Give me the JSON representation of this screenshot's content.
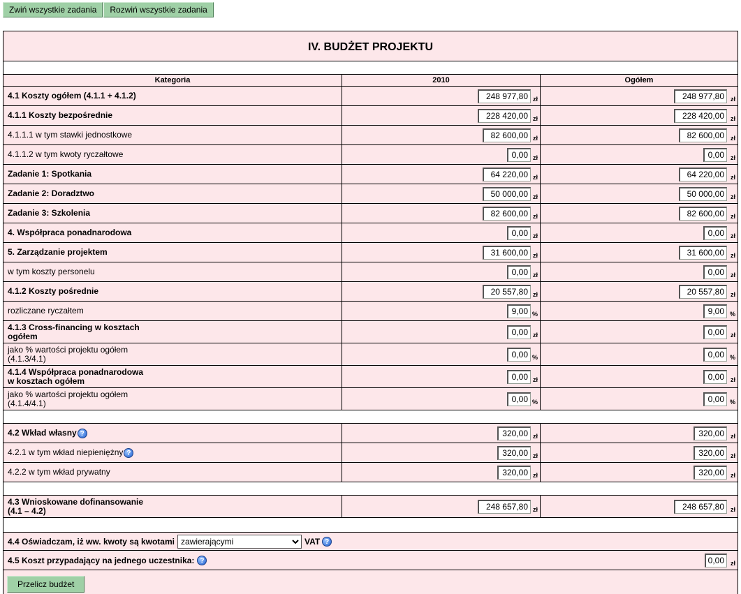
{
  "toolbar": {
    "collapse_label": "Zwiń wszystkie zadania",
    "expand_label": "Rozwiń wszystkie zadania"
  },
  "title": "IV. BUDŻET PROJEKTU",
  "headers": {
    "category": "Kategoria",
    "year": "2010",
    "total": "Ogółem"
  },
  "rows": [
    {
      "label": "4.1 Koszty ogółem (4.1.1 + 4.1.2)",
      "bold": true,
      "v2010": "248 977,80",
      "vtotal": "248 977,80",
      "unit": "zł"
    },
    {
      "label": "4.1.1 Koszty bezpośrednie",
      "bold": true,
      "v2010": "228 420,00",
      "vtotal": "228 420,00",
      "unit": "zł"
    },
    {
      "label": "4.1.1.1 w tym stawki jednostkowe",
      "bold": false,
      "v2010": "82 600,00",
      "vtotal": "82 600,00",
      "unit": "zł"
    },
    {
      "label": "4.1.1.2 w tym kwoty ryczałtowe",
      "bold": false,
      "v2010": "0,00",
      "vtotal": "0,00",
      "unit": "zł"
    },
    {
      "label": "Zadanie 1: Spotkania",
      "bold": true,
      "v2010": "64 220,00",
      "vtotal": "64 220,00",
      "unit": "zł"
    },
    {
      "label": "Zadanie 2: Doradztwo",
      "bold": true,
      "v2010": "50 000,00",
      "vtotal": "50 000,00",
      "unit": "zł"
    },
    {
      "label": "Zadanie 3: Szkolenia",
      "bold": true,
      "v2010": "82 600,00",
      "vtotal": "82 600,00",
      "unit": "zł"
    },
    {
      "label": "4. Współpraca ponadnarodowa",
      "bold": true,
      "v2010": "0,00",
      "vtotal": "0,00",
      "unit": "zł"
    },
    {
      "label": "5. Zarządzanie projektem",
      "bold": true,
      "v2010": "31 600,00",
      "vtotal": "31 600,00",
      "unit": "zł"
    },
    {
      "label": "w tym koszty personelu",
      "bold": false,
      "v2010": "0,00",
      "vtotal": "0,00",
      "unit": "zł"
    },
    {
      "label": "4.1.2 Koszty pośrednie",
      "bold": true,
      "v2010": "20 557,80",
      "vtotal": "20 557,80",
      "unit": "zł"
    },
    {
      "label": "rozliczane ryczałtem",
      "bold": false,
      "v2010": "9,00",
      "vtotal": "9,00",
      "unit": "%"
    },
    {
      "label": "4.1.3 Cross-financing w kosztach\nogółem",
      "bold": true,
      "v2010": "0,00",
      "vtotal": "0,00",
      "unit": "zł"
    },
    {
      "label": "jako % wartości projektu ogółem\n(4.1.3/4.1)",
      "bold": false,
      "v2010": "0,00",
      "vtotal": "0,00",
      "unit": "%"
    },
    {
      "label": "4.1.4 Współpraca ponadnarodowa\nw kosztach ogółem",
      "bold": true,
      "v2010": "0,00",
      "vtotal": "0,00",
      "unit": "zł"
    },
    {
      "label": "jako % wartości projektu ogółem\n(4.1.4/4.1)",
      "bold": false,
      "v2010": "0,00",
      "vtotal": "0,00",
      "unit": "%"
    }
  ],
  "contrib_rows": [
    {
      "label": "4.2 Wkład własny",
      "bold": true,
      "help": true,
      "v2010": "320,00",
      "vtotal": "320,00",
      "unit": "zł"
    },
    {
      "label": "4.2.1 w tym wkład niepieniężny",
      "bold": false,
      "help": true,
      "v2010": "320,00",
      "vtotal": "320,00",
      "unit": "zł"
    },
    {
      "label": "4.2.2 w tym wkład prywatny",
      "bold": false,
      "help": false,
      "v2010": "320,00",
      "vtotal": "320,00",
      "unit": "zł"
    }
  ],
  "funding_row": {
    "label": "4.3 Wnioskowane dofinansowanie\n(4.1 – 4.2)",
    "v2010": "248 657,80",
    "vtotal": "248 657,80",
    "unit": "zł"
  },
  "declaration": {
    "label": "4.4 Oświadczam, iż ww. kwoty są kwotami",
    "selected": "zawierającymi",
    "suffix": "VAT"
  },
  "per_participant": {
    "label": "4.5 Koszt przypadający na jednego uczestnika:",
    "value": "0,00",
    "unit": "zł"
  },
  "recalc_label": "Przelicz budżet"
}
